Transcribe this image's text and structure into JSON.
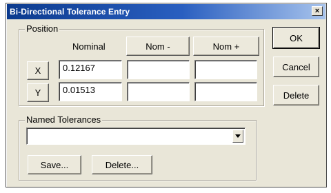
{
  "window": {
    "title": "Bi-Directional Tolerance Entry",
    "close_glyph": "×"
  },
  "position_group": {
    "label": "Position",
    "column_headers": {
      "nominal": "Nominal",
      "nom_minus": "Nom -",
      "nom_plus": "Nom +"
    },
    "rows": [
      {
        "axis": "X",
        "nominal": "0.12167",
        "nom_minus": "",
        "nom_plus": ""
      },
      {
        "axis": "Y",
        "nominal": "0.01513",
        "nom_minus": "",
        "nom_plus": ""
      }
    ]
  },
  "actions": {
    "ok": "OK",
    "cancel": "Cancel",
    "delete": "Delete"
  },
  "named_tolerances": {
    "label": "Named Tolerances",
    "selected": "",
    "save_button": "Save...",
    "delete_button": "Delete..."
  }
}
